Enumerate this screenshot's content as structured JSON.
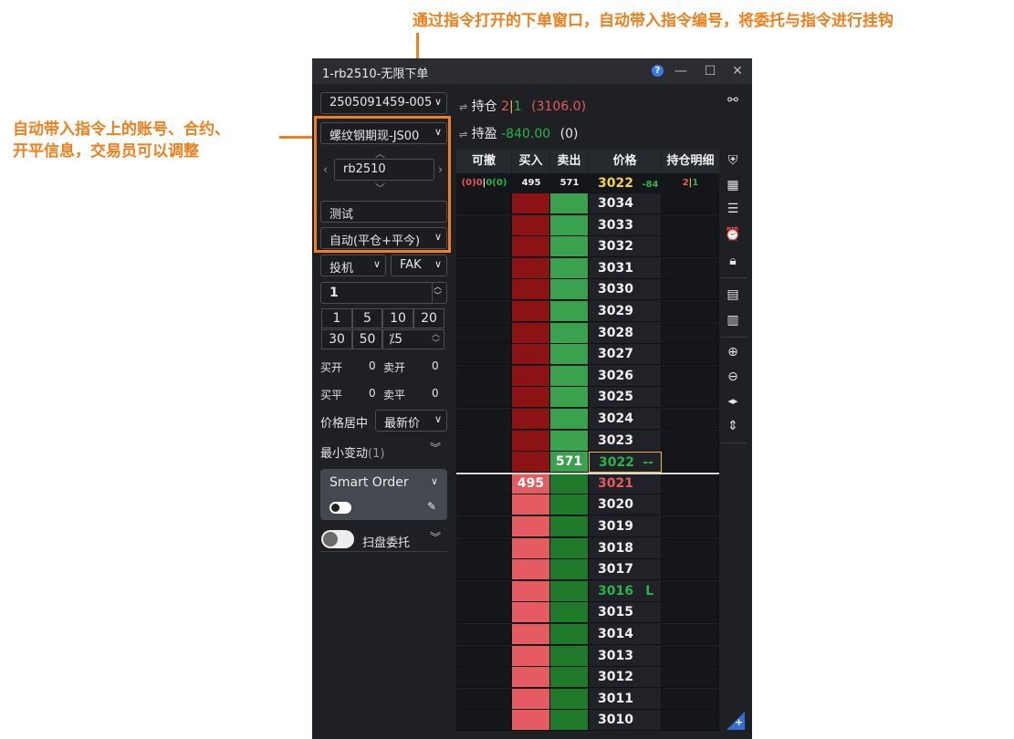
{
  "annotations": {
    "top": "通过指令打开的下单窗口，自动带入指令编号，将委托与指令进行挂钩",
    "left_line1": "自动带入指令上的账号、合约、",
    "left_line2": "开平信息，交易员可以调整"
  },
  "window": {
    "title": "1-rb2510-无限下单",
    "help": "?",
    "minimize": "—",
    "maximize": "☐",
    "close": "✕"
  },
  "order_panel": {
    "instruction_id": "2505091459-005",
    "account": "螺纹钢期现-JS00",
    "contract": "rb2510",
    "remark": "测试",
    "open_close": "自动(平仓+平今)",
    "hedge": "投机",
    "order_type": "FAK",
    "quantity": "1",
    "quick_qty": [
      "1",
      "5",
      "10",
      "20",
      "30",
      "50"
    ],
    "pct_prefix": "⁒",
    "pct_value": "5",
    "buy_open_label": "买开",
    "buy_open_value": "0",
    "sell_open_label": "卖开",
    "sell_open_value": "0",
    "buy_close_label": "买平",
    "buy_close_value": "0",
    "sell_close_label": "卖平",
    "sell_close_value": "0",
    "price_center_label": "价格居中",
    "price_center_value": "最新价",
    "min_tick_label": "最小变动",
    "min_tick_value": "(1)",
    "smart_order_label": "Smart Order",
    "sweep_label": "扫盘委托"
  },
  "position": {
    "hold_label": "持仓",
    "hold_long": "2",
    "hold_sep": "|",
    "hold_short": "1",
    "hold_price": "(3106.0)",
    "pnl_label": "持盈",
    "pnl_value": "-840.00",
    "pnl_count": "(0)"
  },
  "book": {
    "headers": [
      "可撤",
      "买入",
      "卖出",
      "价格",
      "持仓明细"
    ],
    "summary": {
      "cancel_a": "(0)0",
      "cancel_sep": "|",
      "cancel_b": "0(0)",
      "buy_total": "495",
      "sell_total": "571",
      "last_price": "3022",
      "change": "-84",
      "pos_long": "2",
      "pos_sep": "|",
      "pos_short": "1"
    },
    "ask_rows": [
      {
        "price": "3034"
      },
      {
        "price": "3033"
      },
      {
        "price": "3032"
      },
      {
        "price": "3031"
      },
      {
        "price": "3030"
      },
      {
        "price": "3029"
      },
      {
        "price": "3028"
      },
      {
        "price": "3027"
      },
      {
        "price": "3026"
      },
      {
        "price": "3025"
      },
      {
        "price": "3024"
      },
      {
        "price": "3023"
      },
      {
        "price": "3022",
        "sell": "571",
        "flag": "--"
      }
    ],
    "bid_rows": [
      {
        "price": "3021",
        "buy": "495"
      },
      {
        "price": "3020"
      },
      {
        "price": "3019"
      },
      {
        "price": "3018"
      },
      {
        "price": "3017"
      },
      {
        "price": "3016",
        "flag": "L"
      },
      {
        "price": "3015"
      },
      {
        "price": "3014"
      },
      {
        "price": "3013"
      },
      {
        "price": "3012"
      },
      {
        "price": "3011"
      },
      {
        "price": "3010"
      }
    ]
  },
  "colors": {
    "ask_buy": "#8b1313",
    "ask_sell": "#3aa14f",
    "bid_buy": "#e45c62",
    "bid_sell": "#1f7a2c",
    "accent": "#f07f1c"
  },
  "sidebar_icons": [
    "binocular-icon",
    "shield-plus-icon",
    "grid-icon",
    "printer-icon",
    "alarm-icon",
    "lock-icon",
    "list-icon",
    "candlestick-icon",
    "zoom-in-icon",
    "zoom-out-icon",
    "split-horizontal-icon",
    "split-vertical-icon",
    "add-corner-icon"
  ]
}
